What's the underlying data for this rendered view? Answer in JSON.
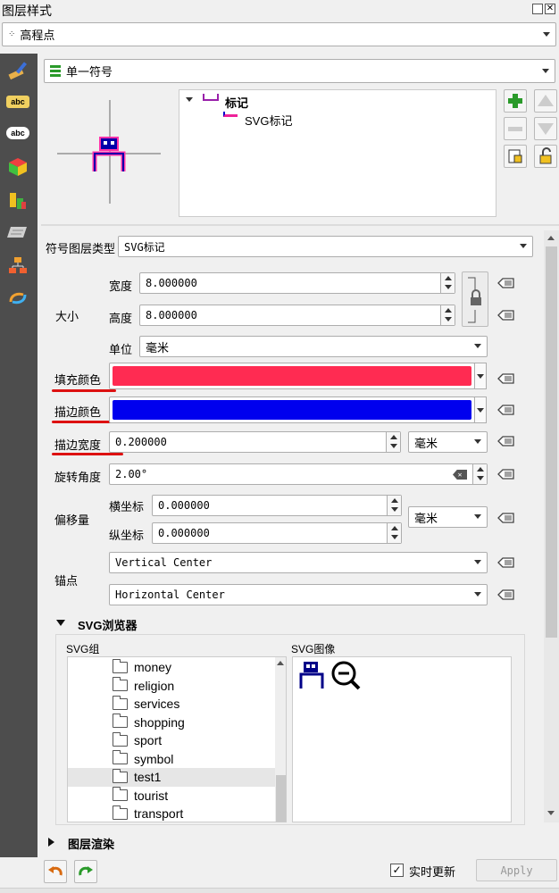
{
  "window": {
    "title": "图层样式"
  },
  "layer_select": {
    "value": "高程点"
  },
  "renderer": {
    "value": "单一符号"
  },
  "symbol_tree": {
    "root": "标记",
    "child": "SVG标记"
  },
  "symbol_layer_type": {
    "label": "符号图层类型",
    "value": "SVG标记"
  },
  "size": {
    "group_label": "大小",
    "width_label": "宽度",
    "width_value": "8.000000",
    "height_label": "高度",
    "height_value": "8.000000",
    "unit_label": "单位",
    "unit_value": "毫米"
  },
  "fill_color": {
    "label": "填充颜色",
    "color": "#ff2b52"
  },
  "stroke_color": {
    "label": "描边颜色",
    "color": "#0000ee"
  },
  "stroke_width": {
    "label": "描边宽度",
    "value": "0.200000",
    "unit": "毫米"
  },
  "rotation": {
    "label": "旋转角度",
    "value": "2.00°"
  },
  "offset": {
    "group_label": "偏移量",
    "x_label": "横坐标",
    "x_value": "0.000000",
    "y_label": "纵坐标",
    "y_value": "0.000000",
    "unit": "毫米"
  },
  "anchor": {
    "label": "锚点",
    "vertical": "Vertical Center",
    "horizontal": "Horizontal Center"
  },
  "svg_browser": {
    "title": "SVG浏览器",
    "groups_header": "SVG组",
    "images_header": "SVG图像",
    "groups": [
      "money",
      "religion",
      "services",
      "shopping",
      "sport",
      "symbol",
      "test1",
      "tourist",
      "transport"
    ],
    "selected_group": "test1"
  },
  "layer_rendering": {
    "title": "图层渲染"
  },
  "footer": {
    "live_update_label": "实时更新",
    "apply_label": "Apply"
  },
  "colors": {
    "accent_underline": "#d11111",
    "symbol_stroke": "#0000aa",
    "symbol_fill": "#ff33aa"
  }
}
